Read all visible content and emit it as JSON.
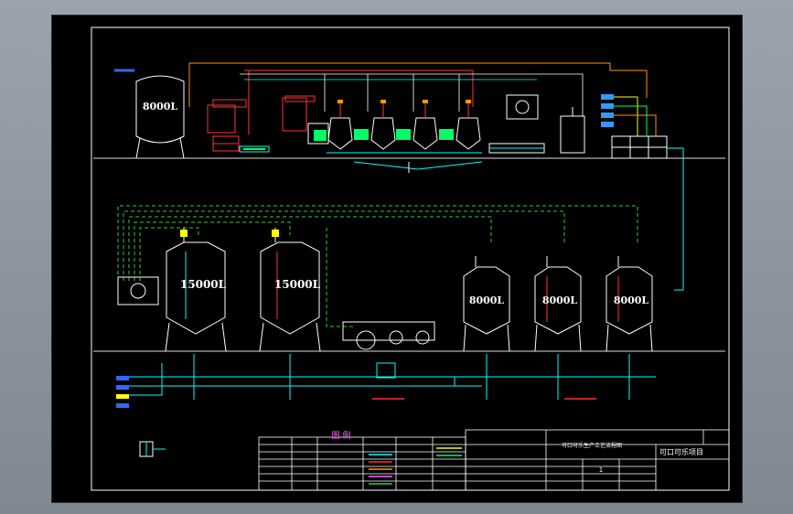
{
  "tanks": {
    "t8000_top": "8000L",
    "t15000_a": "15000L",
    "t15000_b": "15000L",
    "t8000_a": "8000L",
    "t8000_b": "8000L",
    "t8000_c": "8000L"
  },
  "legend": {
    "title": "图 例"
  },
  "title_block": {
    "drawing_title": "可口可乐生产工艺流程图",
    "project_name": "可口可乐项目",
    "scale_value": "1"
  },
  "colors": {
    "process_line": "#00ffff",
    "steam_line": "#ff3333",
    "hot_water_line": "#ff9900",
    "cip_line": "#00ff66",
    "frame_line": "#ffffff"
  }
}
